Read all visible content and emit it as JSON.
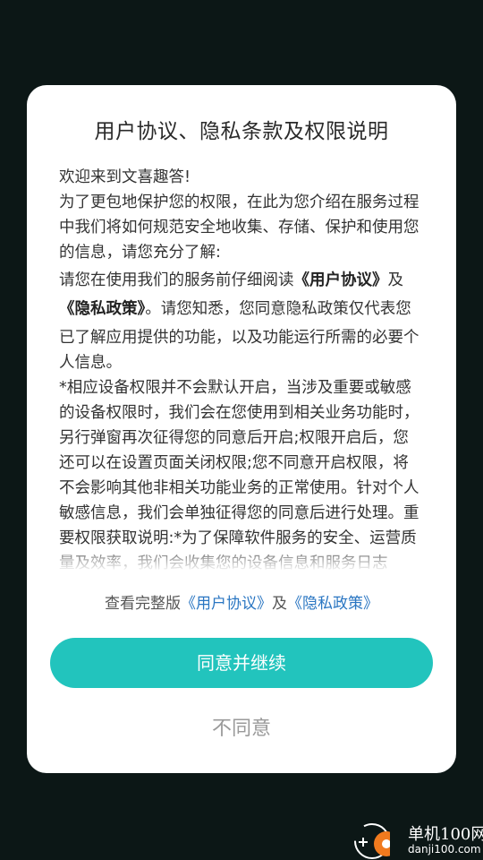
{
  "dialog": {
    "title": "用户协议、隐私条款及权限说明",
    "paragraphs": {
      "p1": "欢迎来到文喜趣答!",
      "p2": "为了更包地保护您的权限，在此为您介绍在服务过程中我们将如何规范安全地收集、存储、保护和使用您的信息，请您充分了解:",
      "p3_prefix": "请您在使用我们的服务前仔细阅读",
      "p3_user_agreement": "《用户协议》",
      "p3_and": "及",
      "p3_privacy_policy": "《隐私政策》",
      "p3_suffix": "。请您知悉，您同意隐私政策仅代表您已了解应用提供的功能，以及功能运行所需的必要个人信息。",
      "p4": "*相应设备权限并不会默认开启，当涉及重要或敏感的设备权限时，我们会在您使用到相关业务功能时，另行弹窗再次征得您的同意后开启;权限开启后，您还可以在设置页面关闭权限;您不同意开启权限，将不会影响其他非相关功能业务的正常使用。针对个人敏感信息，我们会单独征得您的同意后进行处理。重要权限获取说明:*为了保障软件服务的安全、运营质量及效率，我们会收集您的设备信息和服务日志"
    },
    "full_version": {
      "prefix": "查看完整版",
      "user_agreement_link": "《用户协议》",
      "and": "及",
      "privacy_policy_link": "《隐私政策》"
    },
    "agree_button": "同意并继续",
    "disagree_button": "不同意"
  },
  "watermark": {
    "line1": "单机100网",
    "line2": "danji100.com"
  },
  "colors": {
    "background": "#0c1716",
    "accent": "#22c4bd",
    "link": "#2a76c2",
    "watermark_orange": "#f07a1e"
  }
}
